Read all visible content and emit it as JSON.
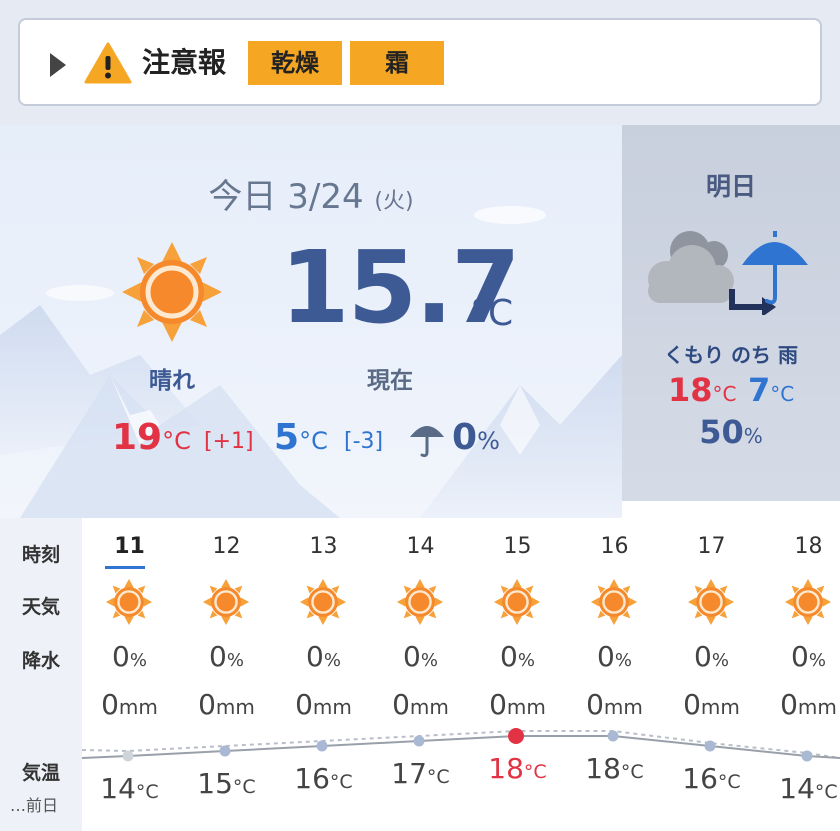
{
  "alert": {
    "title": "注意報",
    "badges": [
      "乾燥",
      "霜"
    ]
  },
  "today": {
    "date_label": "今日 3/24",
    "day_of_week": "(火)",
    "current_temp": "15.7",
    "temp_unit": "°C",
    "now_label": "現在",
    "weather": "晴れ",
    "weather_icon": "sun-icon",
    "high": "19",
    "high_diff": "[+1]",
    "low": "5",
    "low_diff": "[-3]",
    "rain_chance": "0",
    "unit_c": "°C",
    "unit_pct": "%"
  },
  "tomorrow": {
    "title": "明日",
    "weather": "くもり のち 雨",
    "weather_icon": "cloudy-then-rain-icon",
    "high": "18",
    "low": "7",
    "rain_chance": "50",
    "unit_c": "°C",
    "unit_pct": "%"
  },
  "hourly": {
    "labels": {
      "time": "時刻",
      "weather": "天気",
      "precip": "降水",
      "temp": "気温",
      "prev_day": "…前日"
    },
    "unit_pct": "%",
    "unit_mm": "mm",
    "unit_c": "°C",
    "hours": [
      {
        "hour": "11",
        "precip": "0",
        "mm": "0",
        "temp": "14"
      },
      {
        "hour": "12",
        "precip": "0",
        "mm": "0",
        "temp": "15"
      },
      {
        "hour": "13",
        "precip": "0",
        "mm": "0",
        "temp": "16"
      },
      {
        "hour": "14",
        "precip": "0",
        "mm": "0",
        "temp": "17"
      },
      {
        "hour": "15",
        "precip": "0",
        "mm": "0",
        "temp": "18"
      },
      {
        "hour": "16",
        "precip": "0",
        "mm": "0",
        "temp": "18"
      },
      {
        "hour": "17",
        "precip": "0",
        "mm": "0",
        "temp": "16"
      },
      {
        "hour": "18",
        "precip": "0",
        "mm": "0",
        "temp": "14"
      }
    ],
    "current_hour_index": 0,
    "max_hour_index": 4
  },
  "colors": {
    "high": "#e23344",
    "low": "#2f74d0",
    "badge": "#f5a623",
    "sun": "#f5892b",
    "sun_ray": "#f7a13a",
    "accent_blue": "#3d5a94"
  }
}
